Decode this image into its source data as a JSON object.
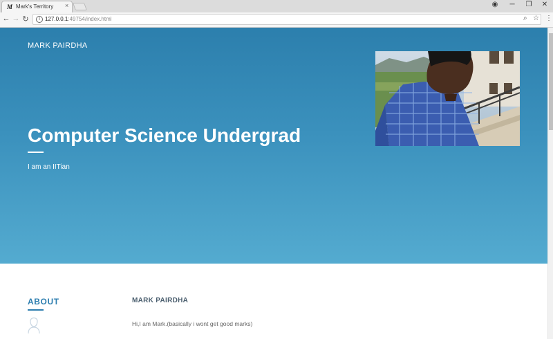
{
  "browser": {
    "tab_title": "Mark's Territory",
    "favicon": "M",
    "close_glyph": "×",
    "url_host": "127.0.0.1",
    "url_path": ":49754/index.html",
    "icons": {
      "back": "←",
      "forward": "→",
      "reload": "↻",
      "info": "i",
      "zoom": "⌕",
      "bookmark": "☆",
      "menu": "⋮",
      "account": "◉",
      "minimize": "─",
      "maximize": "❐",
      "close": "✕"
    }
  },
  "hero": {
    "brand": "MARK PAIRDHA",
    "title": "Computer Science Undergrad",
    "subtitle": "I am an IITian"
  },
  "about": {
    "heading": "ABOUT",
    "name": "MARK PAIRDHA",
    "text": "Hi,I am Mark.(basically i wont get good marks)"
  }
}
